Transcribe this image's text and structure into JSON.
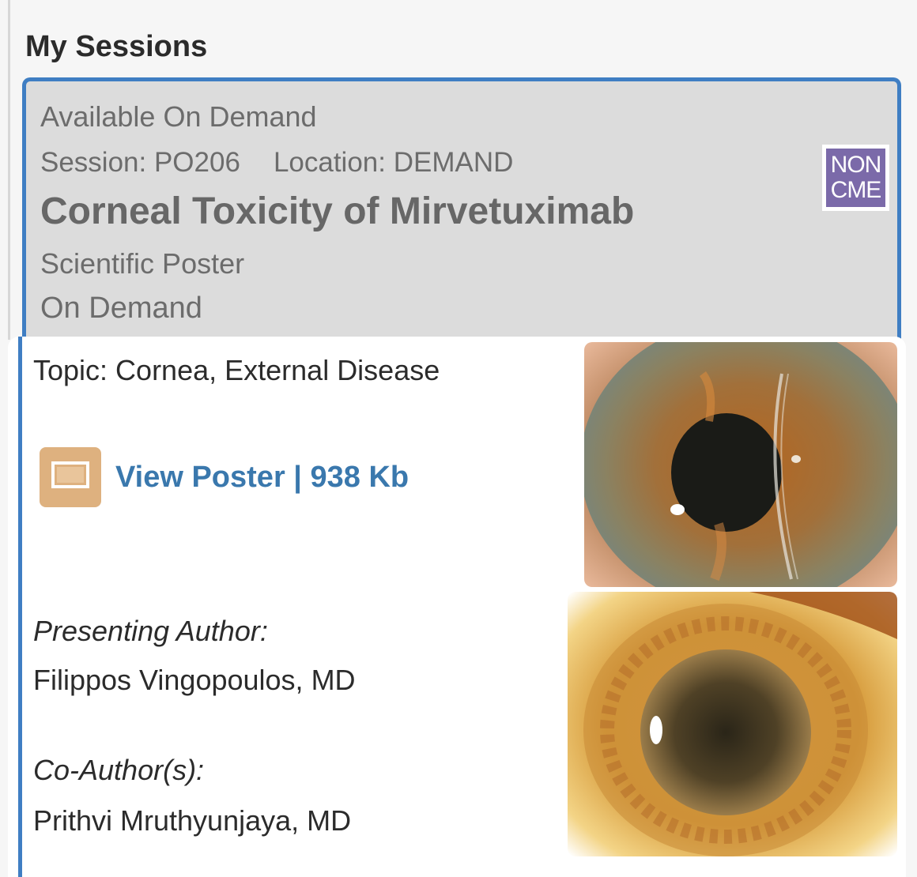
{
  "page": {
    "heading": "My Sessions"
  },
  "session": {
    "availability": "Available On Demand",
    "session_id": "Session: PO206",
    "location": "Location: DEMAND",
    "title": "Corneal Toxicity of Mirvetuximab",
    "type": "Scientific Poster",
    "mode": "On Demand",
    "badge": {
      "line1": "NON",
      "line2": "CME",
      "color": "#7b6aa9"
    }
  },
  "details": {
    "topic": "Topic: Cornea, External Disease",
    "poster_link": {
      "label": "View Poster | 938 Kb",
      "icon": "poster-icon",
      "color": "#3a78ad"
    },
    "presenting_author_label": "Presenting Author:",
    "presenting_author": "Filippos Vingopoulos, MD",
    "coauthors_label": "Co-Author(s):",
    "coauthors": "Prithvi Mruthyunjaya, MD"
  },
  "accent_color": "#3f7ec3"
}
